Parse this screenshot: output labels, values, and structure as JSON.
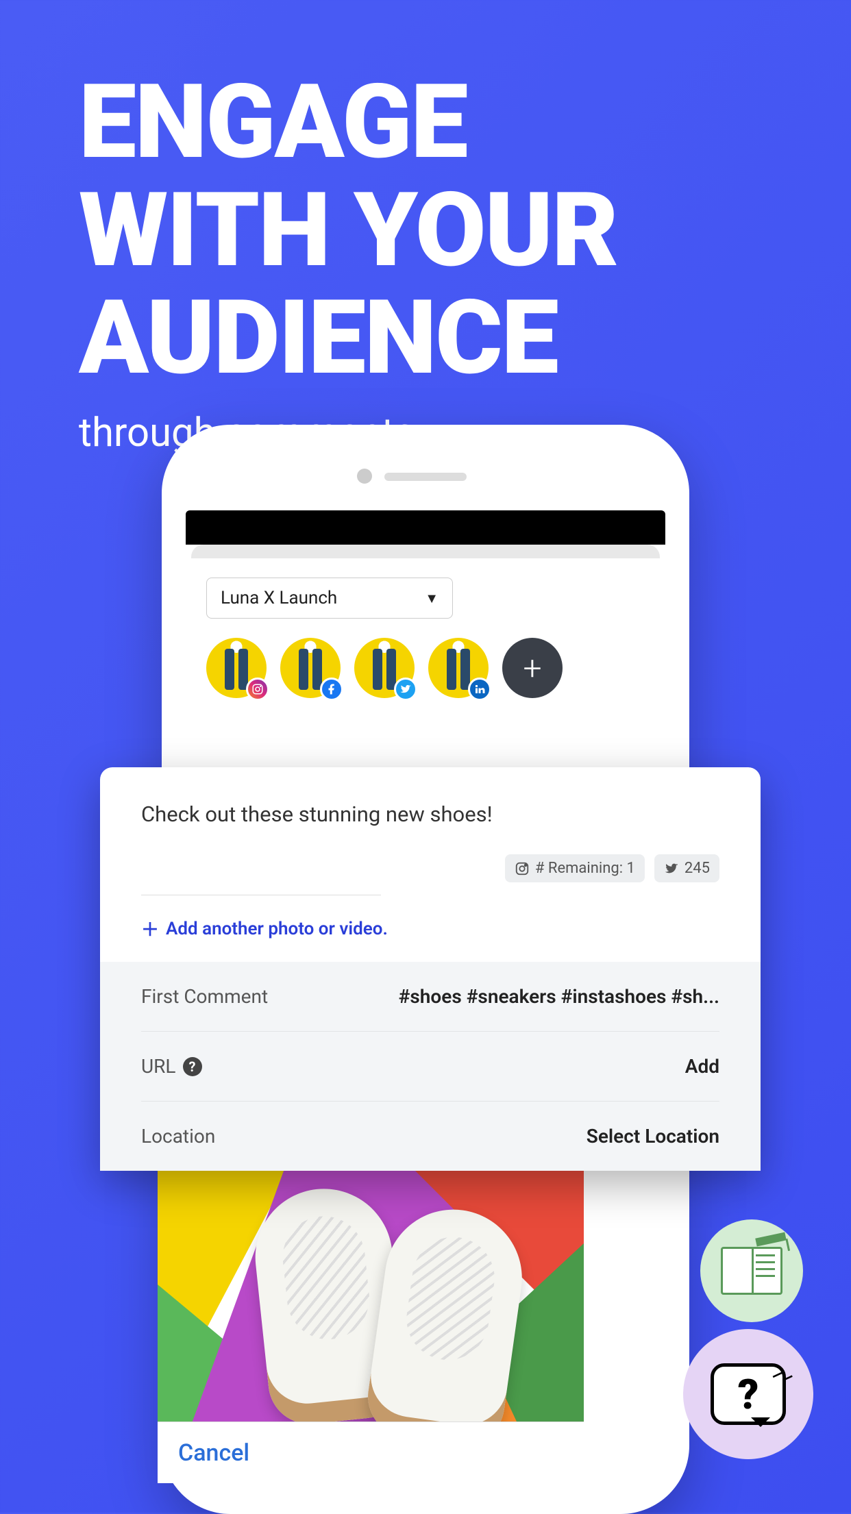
{
  "headline": {
    "line1": "ENGAGE",
    "line2": "WITH YOUR",
    "line3": "AUDIENCE",
    "sub": "through comments"
  },
  "dropdown": {
    "selected": "Luna X Launch"
  },
  "accounts": [
    {
      "network": "instagram"
    },
    {
      "network": "facebook"
    },
    {
      "network": "twitter"
    },
    {
      "network": "linkedin"
    }
  ],
  "caption": "Check out these stunning new shoes!",
  "counters": {
    "instagram_label": "# Remaining: 1",
    "twitter_count": "245"
  },
  "add_media": "Add another photo or video.",
  "options": {
    "first_comment_label": "First Comment",
    "first_comment_value": "#shoes #sneakers #instashoes #sh...",
    "url_label": "URL",
    "url_action": "Add",
    "location_label": "Location",
    "location_action": "Select Location"
  },
  "cancel": "Cancel"
}
